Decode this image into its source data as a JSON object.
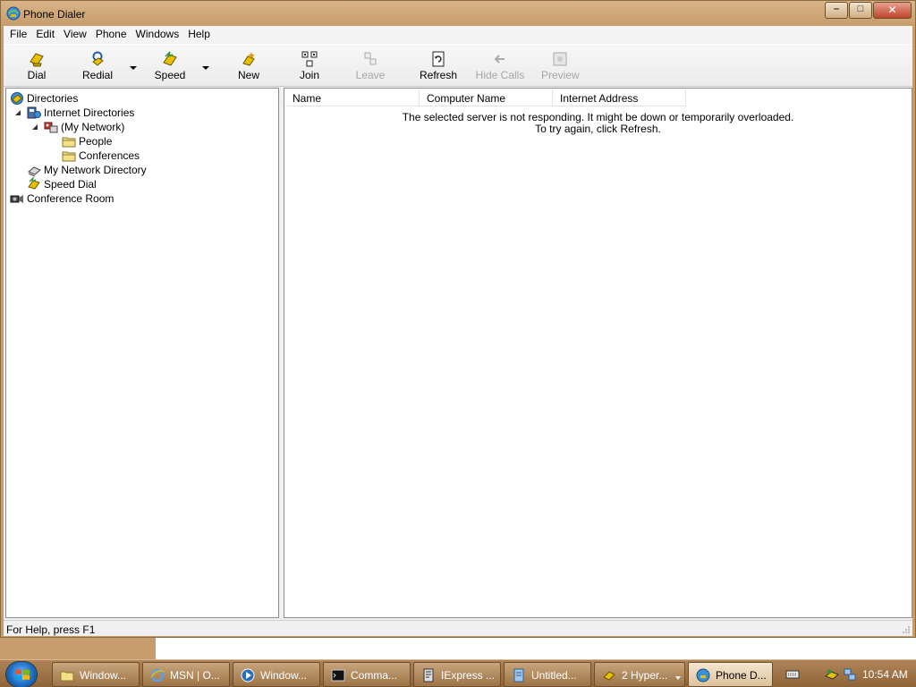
{
  "window": {
    "title": "Phone Dialer",
    "controls": {
      "minimize": "–",
      "maximize": "□",
      "close": "✕"
    }
  },
  "menu": [
    "File",
    "Edit",
    "View",
    "Phone",
    "Windows",
    "Help"
  ],
  "toolbar": [
    {
      "label": "Dial",
      "icon": "dial-icon",
      "enabled": true
    },
    {
      "label": "Redial",
      "icon": "redial-icon",
      "enabled": true,
      "dropdown": true
    },
    {
      "label": "Speed",
      "icon": "speed-dial-icon",
      "enabled": true,
      "dropdown": true
    },
    {
      "label": "New",
      "icon": "new-conference-icon",
      "enabled": true
    },
    {
      "label": "Join",
      "icon": "join-icon",
      "enabled": true
    },
    {
      "label": "Leave",
      "icon": "leave-icon",
      "enabled": false
    },
    {
      "label": "Refresh",
      "icon": "refresh-icon",
      "enabled": true
    },
    {
      "label": "Hide Calls",
      "icon": "hide-calls-icon",
      "enabled": false
    },
    {
      "label": "Preview",
      "icon": "preview-icon",
      "enabled": false
    }
  ],
  "tree": [
    {
      "label": "Directories",
      "icon": "directories-icon"
    },
    {
      "label": "Internet Directories",
      "icon": "internet-directories-icon",
      "expanded": true
    },
    {
      "label": "(My Network)",
      "icon": "network-icon",
      "expanded": true
    },
    {
      "label": "People",
      "icon": "folder-icon"
    },
    {
      "label": "Conferences",
      "icon": "folder-icon"
    },
    {
      "label": "My Network Directory",
      "icon": "network-directory-icon"
    },
    {
      "label": "Speed Dial",
      "icon": "speed-dial-icon"
    },
    {
      "label": "Conference Room",
      "icon": "conference-room-icon"
    }
  ],
  "list": {
    "columns": [
      "Name",
      "Computer Name",
      "Internet Address"
    ],
    "message_line1": "The selected server is not responding. It might be down or temporarily overloaded.",
    "message_line2": "To try again, click Refresh."
  },
  "status": "For Help, press F1",
  "taskbar": {
    "items": [
      {
        "label": "Window...",
        "icon": "folder-icon"
      },
      {
        "label": "MSN | O...",
        "icon": "internet-explorer-icon"
      },
      {
        "label": "Window...",
        "icon": "media-player-icon"
      },
      {
        "label": "Comma...",
        "icon": "command-prompt-icon"
      },
      {
        "label": "IExpress ...",
        "icon": "iexpress-icon"
      },
      {
        "label": "Untitled...",
        "icon": "notepad-icon"
      },
      {
        "label": "2 Hyper...",
        "icon": "hyperterminal-icon",
        "group": true
      },
      {
        "label": "Phone D...",
        "icon": "phone-dialer-icon",
        "active": true
      }
    ],
    "clock": "10:54 AM"
  },
  "colors": {
    "window_frame": "#c69c6d",
    "taskbar": "#9c7347",
    "disabled_text": "#a6a6a6"
  }
}
